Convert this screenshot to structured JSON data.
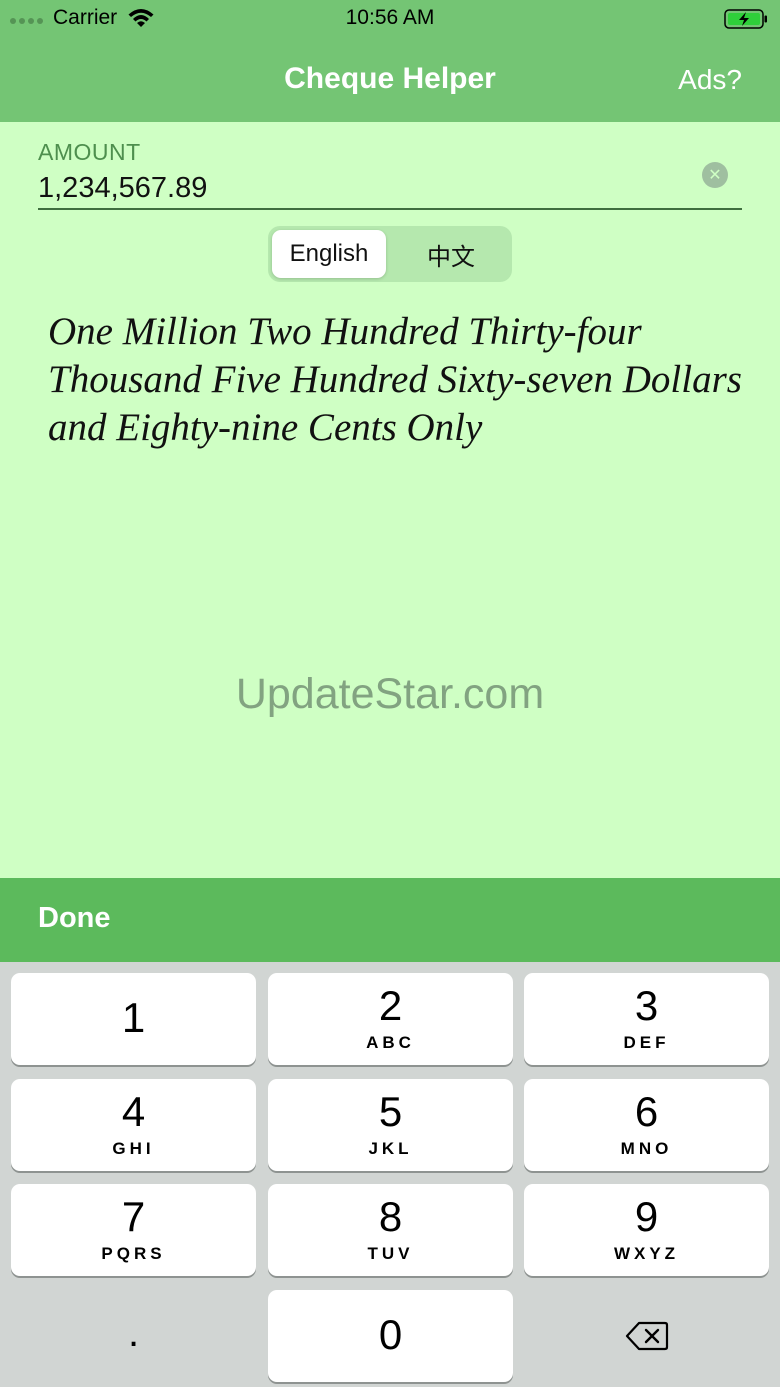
{
  "status_bar": {
    "carrier": "Carrier",
    "time": "10:56 AM"
  },
  "nav": {
    "title": "Cheque Helper",
    "ads_label": "Ads?"
  },
  "amount": {
    "label": "AMOUNT",
    "value": "1,234,567.89"
  },
  "language": {
    "options": [
      "English",
      "中文"
    ],
    "selected": "English"
  },
  "result_text": "One Million Two Hundred Thirty-four Thousand Five Hundred Sixty-seven Dollars and Eighty-nine Cents Only",
  "watermark": "UpdateStar.com",
  "done_label": "Done",
  "keypad": {
    "keys": [
      {
        "num": "1",
        "letters": ""
      },
      {
        "num": "2",
        "letters": "ABC"
      },
      {
        "num": "3",
        "letters": "DEF"
      },
      {
        "num": "4",
        "letters": "GHI"
      },
      {
        "num": "5",
        "letters": "JKL"
      },
      {
        "num": "6",
        "letters": "MNO"
      },
      {
        "num": "7",
        "letters": "PQRS"
      },
      {
        "num": "8",
        "letters": "TUV"
      },
      {
        "num": "9",
        "letters": "WXYZ"
      },
      {
        "num": "0",
        "letters": ""
      }
    ],
    "decimal": "."
  },
  "colors": {
    "nav_green": "#74c574",
    "background": "#cfffc4",
    "done_bar": "#5cba5c",
    "keypad_bg": "#d1d5d3"
  },
  "icons": [
    "signal-dots-icon",
    "wifi-icon",
    "battery-charging-icon",
    "clear-icon",
    "backspace-icon"
  ]
}
